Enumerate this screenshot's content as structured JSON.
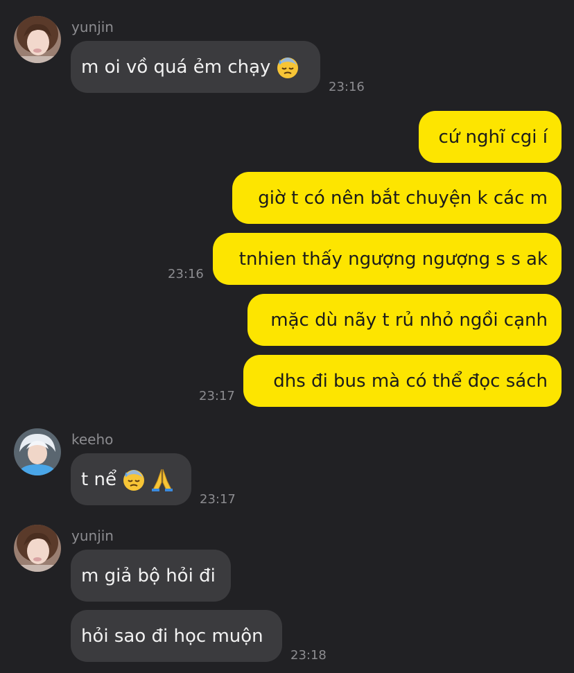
{
  "messages": [
    {
      "sender": "yunjin",
      "text": "m oi vồ quá ẻm chạy",
      "emoji": "sweat-face-icon"
    },
    {
      "text": "cứ nghĩ cgi í"
    },
    {
      "text": "giờ t có nên bắt chuyện k các m"
    },
    {
      "text": "tnhien thấy ngượng ngượng s s ak"
    },
    {
      "text": "mặc dù nãy t rủ nhỏ ngồi cạnh"
    },
    {
      "text": "dhs đi bus mà có thể đọc sách"
    },
    {
      "sender": "keeho",
      "text": "t nể",
      "emojis": [
        "sweat-face-icon",
        "folded-hands-icon"
      ]
    },
    {
      "sender": "yunjin",
      "text": "m giả bộ hỏi đi"
    },
    {
      "text": "hỏi sao đi học muộn"
    }
  ],
  "timestamps": [
    "23:16",
    "23:16",
    "23:17",
    "23:17",
    "23:18"
  ],
  "colors": {
    "background": "#212124",
    "incoming_bubble": "#3b3b3e",
    "outgoing_bubble": "#fde500",
    "meta_text": "#8c8c90"
  }
}
